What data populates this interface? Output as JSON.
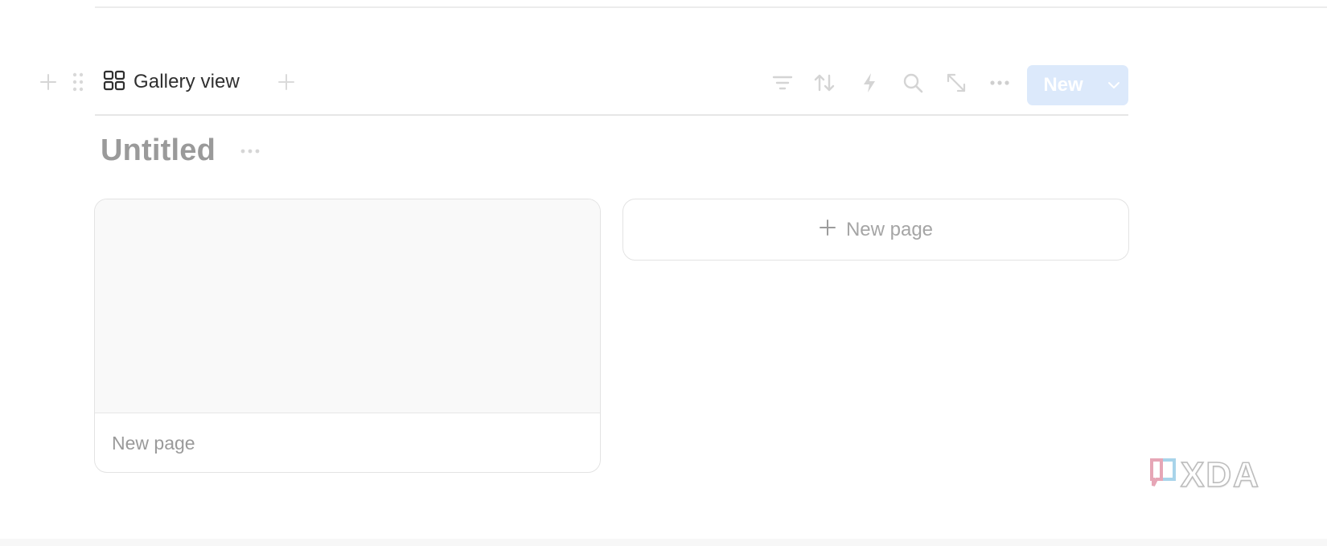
{
  "toolbar": {
    "view_tab": {
      "label": "Gallery view",
      "icon": "gallery-grid-icon"
    },
    "icons": [
      "filter-icon",
      "sort-icon",
      "automation-bolt-icon",
      "search-icon",
      "expand-icon",
      "more-icon"
    ],
    "new_button": {
      "label": "New",
      "color": "#dce9fb",
      "dropdown_icon": "chevron-down-icon"
    }
  },
  "database": {
    "title": "Untitled"
  },
  "gallery": {
    "cards": [
      {
        "title": "New page"
      }
    ],
    "new_page_label": "New page"
  },
  "watermark": {
    "text": "XDA"
  }
}
